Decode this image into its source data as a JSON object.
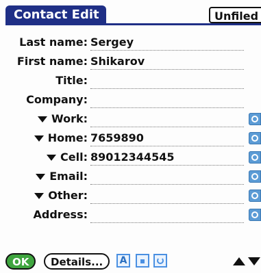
{
  "window": {
    "title": "Contact Edit",
    "category": "Unfiled"
  },
  "fields": [
    {
      "label": "Last name:",
      "value": "Sergey",
      "dropdown": false,
      "indent": 0,
      "note_icon": false
    },
    {
      "label": "First name:",
      "value": "Shikarov",
      "dropdown": false,
      "indent": 0,
      "note_icon": false
    },
    {
      "label": "Title:",
      "value": "",
      "dropdown": false,
      "indent": 0,
      "note_icon": false
    },
    {
      "label": "Company:",
      "value": "",
      "dropdown": false,
      "indent": 0,
      "note_icon": false
    },
    {
      "label": "Work:",
      "value": "",
      "dropdown": true,
      "indent": 0,
      "note_icon": true
    },
    {
      "label": "Home:",
      "value": "7659890",
      "dropdown": true,
      "indent": 0,
      "note_icon": true
    },
    {
      "label": "Cell:",
      "value": "89012344545",
      "dropdown": true,
      "indent": 0,
      "note_icon": true
    },
    {
      "label": "Email:",
      "value": "",
      "dropdown": true,
      "indent": 0,
      "note_icon": true
    },
    {
      "label": "Other:",
      "value": "",
      "dropdown": true,
      "indent": 0,
      "note_icon": true
    },
    {
      "label": "Address:",
      "value": "",
      "dropdown": false,
      "indent": 0,
      "note_icon": true
    }
  ],
  "toolbar": {
    "ok_label": "OK",
    "details_label": "Details...",
    "text_icon_glyph": "A",
    "icons": [
      "text-format-icon",
      "lock-icon",
      "rotate-icon"
    ],
    "scroll": [
      "scroll-up-icon",
      "scroll-down-icon"
    ]
  },
  "colors": {
    "title_bg": "#1f2f86",
    "ok_bg": "#3fa53f",
    "icon_blue": "#4a90e2"
  }
}
